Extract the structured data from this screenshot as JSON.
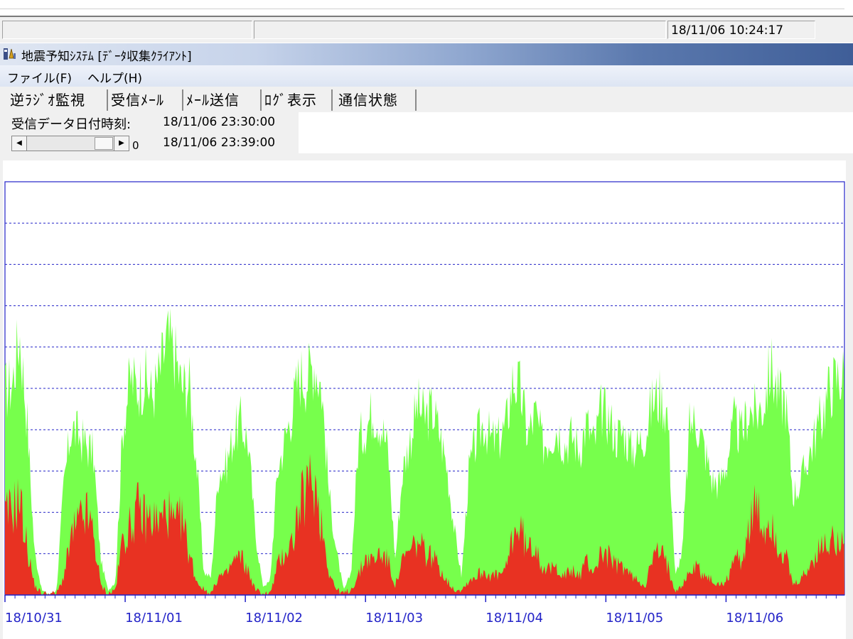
{
  "status_bar": {
    "datetime": "18/11/06 10:24:17"
  },
  "window": {
    "title": "地震予知ｼｽﾃﾑ [ﾃﾞｰﾀ収集ｸﾗｲｱﾝﾄ]"
  },
  "menu": [
    {
      "label": "ファイル(F)"
    },
    {
      "label": "ヘルプ(H)"
    }
  ],
  "tabs": [
    {
      "label": "逆ﾗｼﾞｵ監視",
      "active": true
    },
    {
      "label": "受信ﾒｰﾙ"
    },
    {
      "label": "ﾒｰﾙ送信"
    },
    {
      "label": "ﾛｸﾞ表示"
    },
    {
      "label": "通信状態"
    }
  ],
  "info": {
    "received_label": "受信データ日付時刻:",
    "time1": "18/11/06 23:30:00",
    "time2": "18/11/06 23:39:00",
    "scroll_value": "0"
  },
  "colors": {
    "green": "#77ff4c",
    "red": "#e83222",
    "axis": "#2323c8"
  },
  "chart_data": {
    "type": "area",
    "x_tick_labels": [
      "18/10/31",
      "18/11/01",
      "18/11/02",
      "18/11/03",
      "18/11/04",
      "18/11/05",
      "18/11/06"
    ],
    "x_range": [
      "18/10/31 00:00",
      "18/11/06 23:39"
    ],
    "y_range": [
      0,
      10
    ],
    "y_grid_lines": [
      1,
      2,
      3,
      4,
      5,
      6,
      7,
      8,
      9
    ],
    "grid": "dashed horizontal",
    "series": [
      {
        "color": "green",
        "values": [
          4.6,
          4.8,
          5.9,
          4.0,
          1.0,
          0.1,
          0.0,
          0.1,
          2.5,
          3.8,
          3.6,
          3.4,
          3.2,
          0.8,
          0.1,
          0.3,
          3.8,
          4.9,
          4.7,
          4.9,
          4.5,
          5.0,
          5.8,
          5.5,
          4.7,
          4.8,
          3.0,
          0.5,
          0.4,
          2.8,
          2.9,
          3.6,
          3.9,
          3.5,
          1.4,
          0.2,
          0.3,
          2.8,
          3.5,
          4.2,
          5.0,
          4.9,
          5.3,
          4.7,
          2.3,
          1.0,
          0.1,
          0.5,
          3.5,
          3.8,
          4.2,
          3.9,
          3.3,
          0.8,
          2.8,
          3.5,
          4.3,
          4.0,
          4.2,
          3.7,
          2.9,
          1.5,
          0.4,
          2.8,
          3.5,
          3.9,
          3.5,
          3.5,
          3.8,
          4.9,
          4.6,
          3.6,
          4.1,
          3.4,
          3.6,
          3.8,
          3.4,
          3.6,
          3.3,
          3.9,
          3.4,
          4.2,
          4.0,
          3.6,
          3.7,
          3.3,
          3.4,
          3.7,
          4.4,
          4.5,
          4.1,
          0.4,
          1.0,
          3.9,
          3.9,
          3.3,
          2.6,
          2.5,
          3.0,
          3.9,
          3.6,
          4.2,
          4.1,
          4.3,
          5.2,
          4.5,
          4.4,
          2.3,
          2.5,
          3.1,
          3.6,
          4.1,
          4.7,
          4.9,
          5.0
        ],
        "label": ""
      },
      {
        "color": "red",
        "values": [
          1.6,
          1.8,
          2.0,
          1.0,
          0.2,
          0.0,
          0.0,
          0.0,
          0.4,
          1.2,
          1.5,
          1.7,
          1.3,
          0.2,
          0.0,
          0.1,
          1.2,
          1.4,
          1.8,
          1.6,
          1.6,
          1.5,
          1.8,
          1.4,
          1.6,
          0.9,
          0.3,
          0.1,
          0.0,
          0.4,
          0.4,
          0.7,
          0.8,
          0.5,
          0.1,
          0.0,
          0.0,
          0.6,
          0.9,
          1.1,
          1.8,
          2.2,
          2.4,
          1.5,
          0.5,
          0.1,
          0.0,
          0.1,
          0.4,
          0.8,
          0.7,
          0.9,
          0.7,
          0.2,
          0.7,
          0.9,
          1.1,
          0.9,
          0.8,
          0.6,
          0.3,
          0.1,
          0.1,
          0.3,
          0.4,
          0.5,
          0.4,
          0.4,
          0.5,
          1.3,
          1.4,
          0.9,
          1.1,
          0.6,
          0.5,
          0.6,
          0.4,
          0.5,
          0.4,
          0.7,
          0.5,
          0.9,
          0.8,
          0.6,
          0.6,
          0.4,
          0.3,
          0.2,
          0.8,
          0.9,
          0.6,
          0.1,
          0.2,
          0.5,
          0.6,
          0.4,
          0.3,
          0.2,
          0.3,
          0.8,
          0.7,
          1.4,
          1.8,
          1.3,
          1.6,
          1.0,
          0.8,
          0.2,
          0.3,
          0.5,
          0.8,
          1.0,
          1.1,
          1.2,
          1.4
        ],
        "label": ""
      }
    ]
  }
}
